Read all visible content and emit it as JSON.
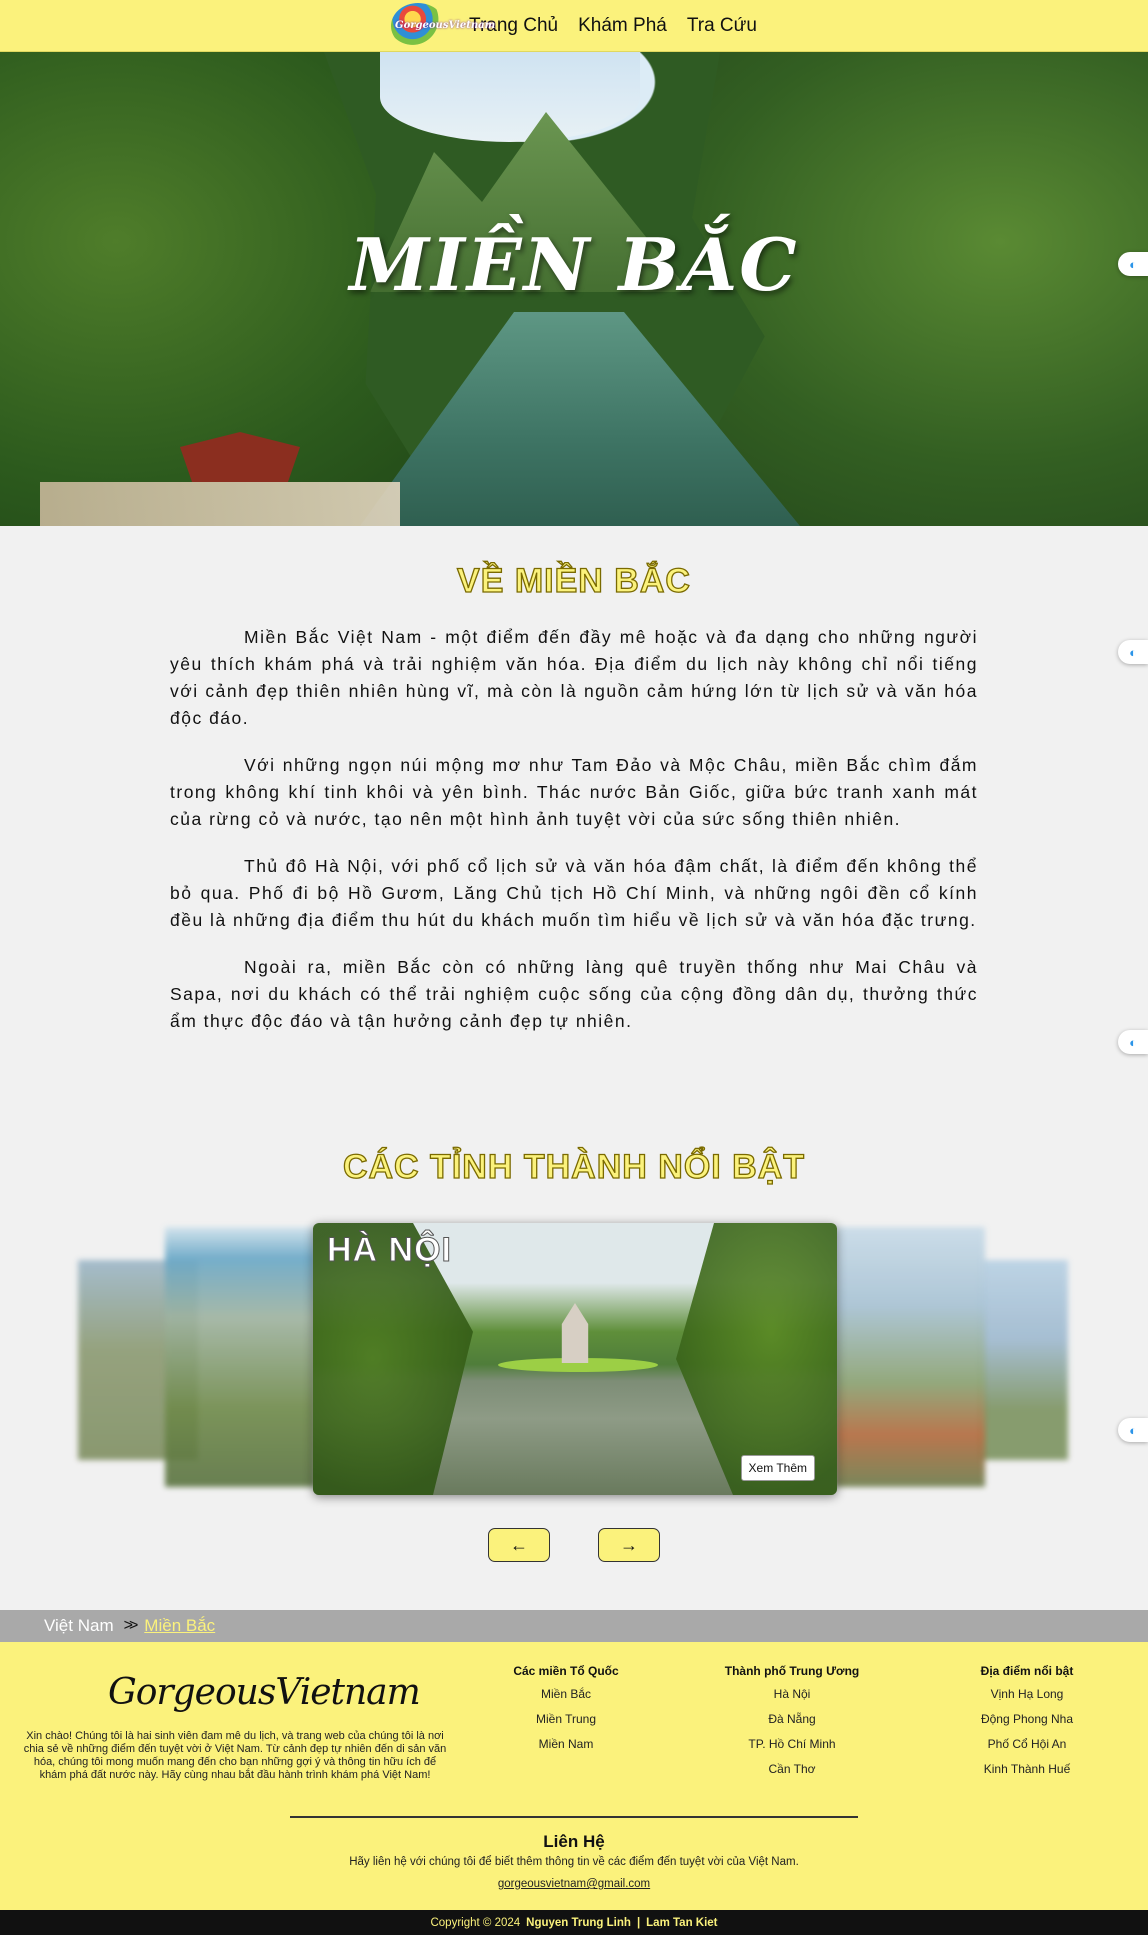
{
  "nav": {
    "logo_text": "GorgeousVietnam",
    "links": [
      "Trang Chủ",
      "Khám Phá",
      "Tra Cứu"
    ]
  },
  "hero": {
    "title": "MIỀN BẮC"
  },
  "about": {
    "title": "VỀ MIỀN BẮC",
    "paragraphs": [
      "Miền Bắc Việt Nam - một điểm đến đầy mê hoặc và đa dạng cho những người yêu thích khám phá và trải nghiệm văn hóa. Địa điểm du lịch này không chỉ nổi tiếng với cảnh đẹp thiên nhiên hùng vĩ, mà còn là nguồn cảm hứng lớn từ lịch sử và văn hóa độc đáo.",
      "Với những ngọn núi mộng mơ như Tam Đảo và Mộc Châu, miền Bắc chìm đắm trong không khí tinh khôi và yên bình. Thác nước Bản Giốc, giữa bức tranh xanh mát của rừng cỏ và nước, tạo nên một hình ảnh tuyệt vời của sức sống thiên nhiên.",
      "Thủ đô Hà Nội, với phố cổ lịch sử và văn hóa đậm chất, là điểm đến không thể bỏ qua. Phố đi bộ Hồ Gươm, Lăng Chủ tịch Hồ Chí Minh, và những ngôi đền cổ kính đều là những địa điểm thu hút du khách muốn tìm hiểu về lịch sử và văn hóa đặc trưng.",
      "Ngoài ra, miền Bắc còn có những làng quê truyền thống như Mai Châu và Sapa, nơi du khách có thể trải nghiệm cuộc sống của cộng đồng dân dụ, thưởng thức ẩm thực độc đáo và tận hưởng cảnh đẹp tự nhiên."
    ]
  },
  "provinces": {
    "title": "CÁC TỈNH THÀNH NỔI BẬT",
    "active_card": {
      "name": "HÀ NỘI",
      "button": "Xem Thêm"
    },
    "prev_icon": "arrow-left-icon",
    "next_icon": "arrow-right-icon"
  },
  "breadcrumb": {
    "root": "Việt Nam",
    "current": "Miền Bắc"
  },
  "footer": {
    "brand": "GorgeousVietnam",
    "intro": "Xin chào! Chúng tôi là hai sinh viên đam mê du lịch, và trang web của chúng tôi là nơi chia sẻ về những điểm đến tuyệt vời ở Việt Nam. Từ cảnh đẹp tự nhiên đến di sản văn hóa, chúng tôi mong muốn mang đến cho bạn những gợi ý và thông tin hữu ích để khám phá đất nước này. Hãy cùng nhau bắt đầu hành trình khám phá Việt Nam!",
    "columns": [
      {
        "title": "Các miền Tổ Quốc",
        "items": [
          "Miền Bắc",
          "Miền Trung",
          "Miền Nam"
        ]
      },
      {
        "title": "Thành phố Trung Ương",
        "items": [
          "Hà Nội",
          "Đà Nẵng",
          "TP. Hồ Chí Minh",
          "Cần Thơ"
        ]
      },
      {
        "title": "Địa điểm nổi bật",
        "items": [
          "Vịnh Hạ Long",
          "Động Phong Nha",
          "Phố Cổ Hội An",
          "Kinh Thành Huế"
        ]
      }
    ],
    "contact": {
      "title": "Liên Hệ",
      "desc": "Hãy liên hệ với chúng tôi để biết thêm thông tin về các điểm đến tuyệt vời của Việt Nam.",
      "email": "gorgeousvietnam@gmail.com"
    },
    "copyright": {
      "prefix": "Copyright © 2024",
      "author1": "Nguyen Trung Linh",
      "divider": "|",
      "author2": "Lam Tan Kiet"
    }
  },
  "colors": {
    "accent": "#fbf27c",
    "breadcrumb_bg": "#a9a9a9",
    "footer_bottom": "#111111"
  }
}
